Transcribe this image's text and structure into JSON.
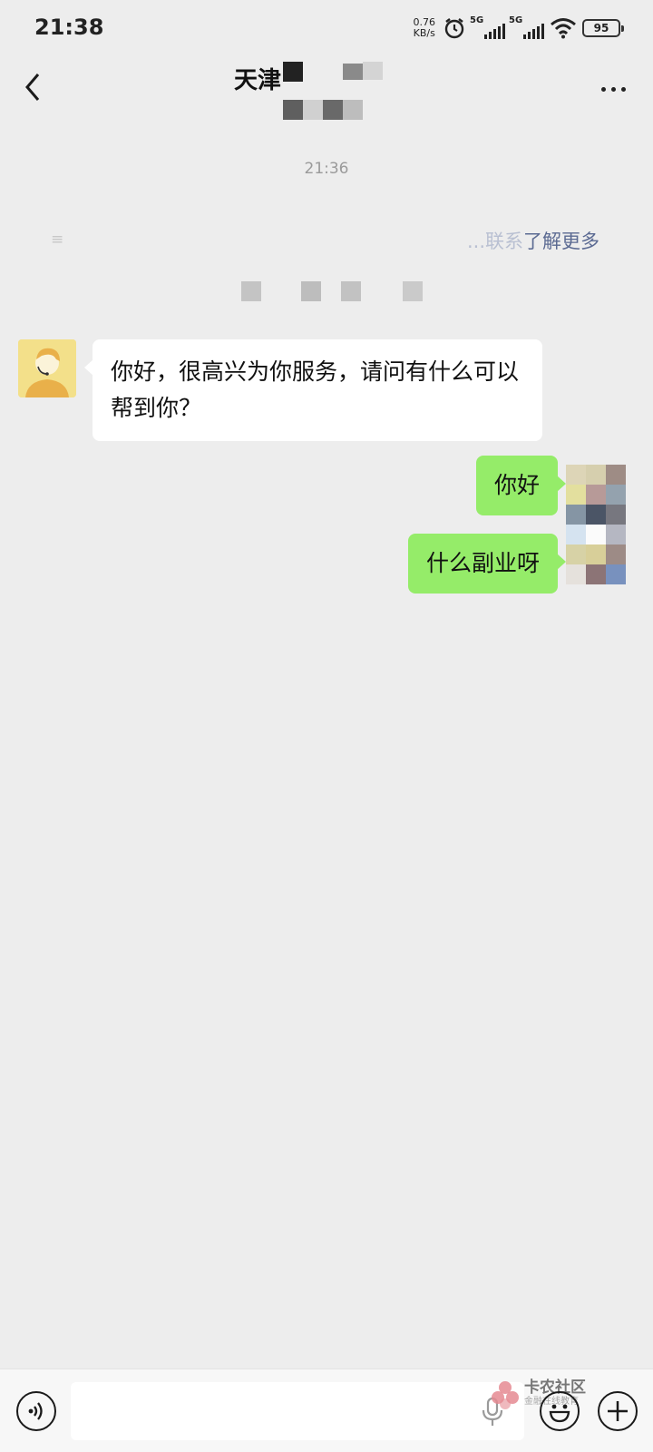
{
  "status_bar": {
    "time": "21:38",
    "net_speed_value": "0.76",
    "net_speed_unit": "KB/s",
    "sim1_label": "5G",
    "sim2_label": "5G",
    "battery": "95",
    "icons": [
      "alarm-icon",
      "signal-icon",
      "wifi-icon",
      "battery-icon"
    ]
  },
  "header": {
    "title": "天津",
    "back_icon": "chevron-left-icon",
    "more_icon": "more-dots-icon"
  },
  "chat": {
    "timestamp": "21:36",
    "notice_left": "≡",
    "notice_link_faded": "...联系",
    "notice_link": "了解更多",
    "messages": [
      {
        "direction": "incoming",
        "text": "你好，很高兴为你服务，请问有什么可以帮到你？"
      },
      {
        "direction": "outgoing",
        "text": "你好"
      },
      {
        "direction": "outgoing",
        "text": "什么副业呀"
      }
    ]
  },
  "input_bar": {
    "voice_icon": "voice-icon",
    "mic_icon": "mic-icon",
    "emoji_icon": "emoji-icon",
    "plus_icon": "plus-icon",
    "watermark_title": "卡农社区",
    "watermark_sub": "金融在线教育"
  },
  "colors": {
    "background": "#ededed",
    "incoming_bubble": "#ffffff",
    "outgoing_bubble": "#95ec69",
    "link": "#5b6a92",
    "timestamp": "#9a9a9a"
  }
}
